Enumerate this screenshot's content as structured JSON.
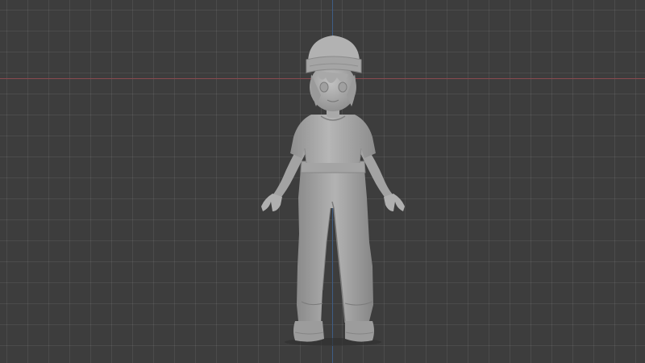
{
  "viewport": {
    "mode": "sculpt-preview",
    "background_color": "#3d3d3d",
    "grid_visible": true,
    "grid_line_color": "#4a4a4a",
    "x_axis_color": "#8a4a4f",
    "y_axis_color": "#3e5d86"
  },
  "model": {
    "icon": "character-mesh",
    "material_color": "#a8a8a8",
    "pose": "A-pose"
  }
}
